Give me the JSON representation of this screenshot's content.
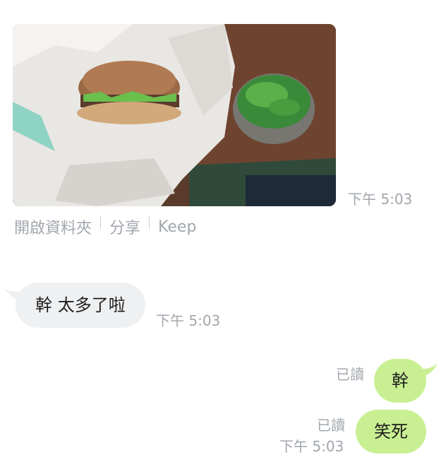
{
  "messages": {
    "photo": {
      "time": "下午 5:03",
      "actions": {
        "open_folder": "開啟資料夾",
        "share": "分享",
        "keep": "Keep"
      }
    },
    "incoming": {
      "text": "幹 太多了啦",
      "time": "下午 5:03"
    },
    "outgoing": [
      {
        "text": "幹",
        "status": "已讀"
      },
      {
        "text": "笑死",
        "status": "已讀",
        "time": "下午 5:03"
      }
    ]
  },
  "colors": {
    "incoming_bubble": "#eef0f2",
    "outgoing_bubble": "#c9ef93",
    "meta_text": "#a2a7ad"
  },
  "icons": [
    "photo-thumbnail",
    "bubble-tail"
  ]
}
